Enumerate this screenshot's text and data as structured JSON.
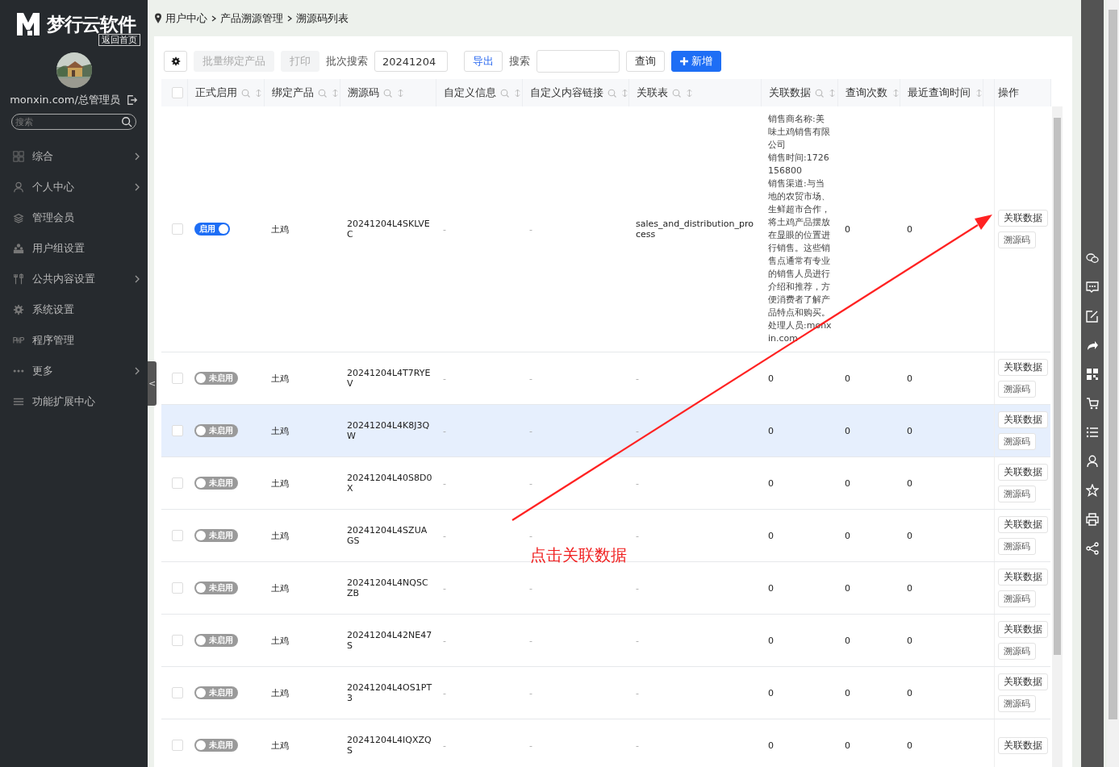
{
  "sidebar": {
    "logo_text": "梦行云软件",
    "home_link": "返回首页",
    "user": "monxin.com/总管理员",
    "search": {
      "placeholder": "搜索"
    },
    "items": [
      {
        "label": "综合",
        "kind": "grid",
        "has_children": true
      },
      {
        "label": "个人中心",
        "kind": "person",
        "has_children": true
      },
      {
        "label": "管理会员",
        "kind": "layers",
        "has_children": false
      },
      {
        "label": "用户组设置",
        "kind": "group",
        "has_children": false
      },
      {
        "label": "公共内容设置",
        "kind": "tools",
        "has_children": true
      },
      {
        "label": "系统设置",
        "kind": "gear",
        "has_children": false
      },
      {
        "label": "程序管理",
        "kind": "php",
        "has_children": false
      },
      {
        "label": "更多",
        "kind": "dots",
        "has_children": true
      },
      {
        "label": "功能扩展中心",
        "kind": "lines",
        "has_children": false
      }
    ],
    "collapse_handle": "<"
  },
  "breadcrumb": [
    "用户中心",
    "产品溯源管理",
    "溯源码列表"
  ],
  "toolbar": {
    "bind_button": {
      "label": "批量绑定产品",
      "disabled": true
    },
    "print_button": {
      "label": "打印",
      "disabled": true
    },
    "batch_label": "批次搜索",
    "batch_value": "20241204",
    "export_button": "导出",
    "search_label": "搜索",
    "query_button": "查询",
    "add_button": "新增"
  },
  "table": {
    "header_checked": false,
    "columns": [
      {
        "label": "正式启用",
        "search": true,
        "sort": true
      },
      {
        "label": "绑定产品",
        "search": true,
        "sort": true
      },
      {
        "label": "溯源码",
        "search": true,
        "sort": true
      },
      {
        "label": "自定义信息",
        "search": true,
        "sort": true
      },
      {
        "label": "自定义内容链接",
        "search": true,
        "sort": true
      },
      {
        "label": "关联表",
        "search": true,
        "sort": true
      },
      {
        "label": "关联数据",
        "search": true,
        "sort": true
      },
      {
        "label": "查询次数",
        "search": false,
        "sort": true
      },
      {
        "label": "最近查询时间",
        "search": false,
        "sort": true
      },
      {
        "label": "操作",
        "search": false,
        "sort": false
      }
    ],
    "rows": [
      {
        "checked": false,
        "selected": false,
        "enabled": true,
        "toggle_label": "启用",
        "product": "土鸡",
        "code": "20241204L4SKLVEC",
        "custom_info": "-",
        "custom_link": "-",
        "related_table": "sales_and_distribution_process",
        "related_data": [
          "销售商名称:美味土鸡销售有限公司",
          "销售时间:1726156800",
          "销售渠道:与当地的农贸市场、生鲜超市合作，将土鸡产品摆放在显眼的位置进行销售。这些销售点通常有专业的销售人员进行介绍和推荐，方便消费者了解产品特点和购买。",
          "处理人员:monxin.com"
        ],
        "query_count": "0",
        "last_query": "0",
        "actions": [
          "关联数据",
          "溯源码"
        ]
      },
      {
        "checked": false,
        "selected": false,
        "enabled": false,
        "toggle_label": "未启用",
        "product": "土鸡",
        "code": "20241204L4T7RYEV",
        "custom_info": "-",
        "custom_link": "-",
        "related_table": "-",
        "related_data": [
          "0"
        ],
        "query_count": "0",
        "last_query": "0",
        "actions": [
          "关联数据",
          "溯源码"
        ]
      },
      {
        "checked": false,
        "selected": true,
        "enabled": false,
        "toggle_label": "未启用",
        "product": "土鸡",
        "code": "20241204L4K8J3QW",
        "custom_info": "-",
        "custom_link": "-",
        "related_table": "-",
        "related_data": "0",
        "query_count": "0",
        "last_query": "0",
        "actions": [
          "关联数据",
          "溯源码"
        ]
      },
      {
        "checked": false,
        "selected": false,
        "enabled": false,
        "toggle_label": "未启用",
        "product": "土鸡",
        "code": "20241204L40S8D0X",
        "custom_info": "-",
        "custom_link": "-",
        "related_table": "-",
        "related_data": "0",
        "query_count": "0",
        "last_query": "0",
        "actions": [
          "关联数据",
          "溯源码"
        ]
      },
      {
        "checked": false,
        "selected": false,
        "enabled": false,
        "toggle_label": "未启用",
        "product": "土鸡",
        "code": "20241204L4SZUAGS",
        "custom_info": "-",
        "custom_link": "-",
        "related_table": "-",
        "related_data": "0",
        "query_count": "0",
        "last_query": "0",
        "actions": [
          "关联数据",
          "溯源码"
        ]
      },
      {
        "checked": false,
        "selected": false,
        "enabled": false,
        "toggle_label": "未启用",
        "product": "土鸡",
        "code": "20241204L4NQSCZB",
        "custom_info": "-",
        "custom_link": "-",
        "related_table": "-",
        "related_data": "0",
        "query_count": "0",
        "last_query": "0",
        "actions": [
          "关联数据",
          "溯源码"
        ]
      },
      {
        "checked": false,
        "selected": false,
        "enabled": false,
        "toggle_label": "未启用",
        "product": "土鸡",
        "code": "20241204L42NE47S",
        "custom_info": "-",
        "custom_link": "-",
        "related_table": "-",
        "related_data": "0",
        "query_count": "0",
        "last_query": "0",
        "actions": [
          "关联数据",
          "溯源码"
        ]
      },
      {
        "checked": false,
        "selected": false,
        "enabled": false,
        "toggle_label": "未启用",
        "product": "土鸡",
        "code": "20241204L4OS1PT3",
        "custom_info": "-",
        "custom_link": "-",
        "related_table": "-",
        "related_data": "0",
        "query_count": "0",
        "last_query": "0",
        "actions": [
          "关联数据",
          "溯源码"
        ]
      },
      {
        "checked": false,
        "selected": false,
        "enabled": false,
        "toggle_label": "未启用",
        "product": "土鸡",
        "code": "20241204L4IQXZQS",
        "custom_info": "-",
        "custom_link": "-",
        "related_table": "-",
        "related_data": "0",
        "query_count": "0",
        "last_query": "0",
        "actions": [
          "关联数据"
        ]
      }
    ]
  },
  "annotation": {
    "text": "点击关联数据"
  },
  "side_tools": [
    {
      "kind": "chat"
    },
    {
      "kind": "message"
    },
    {
      "kind": "edit"
    },
    {
      "kind": "share-arrow"
    },
    {
      "kind": "qr"
    },
    {
      "kind": "cart"
    },
    {
      "kind": "list"
    },
    {
      "kind": "user"
    },
    {
      "kind": "star"
    },
    {
      "kind": "print"
    },
    {
      "kind": "share"
    }
  ]
}
